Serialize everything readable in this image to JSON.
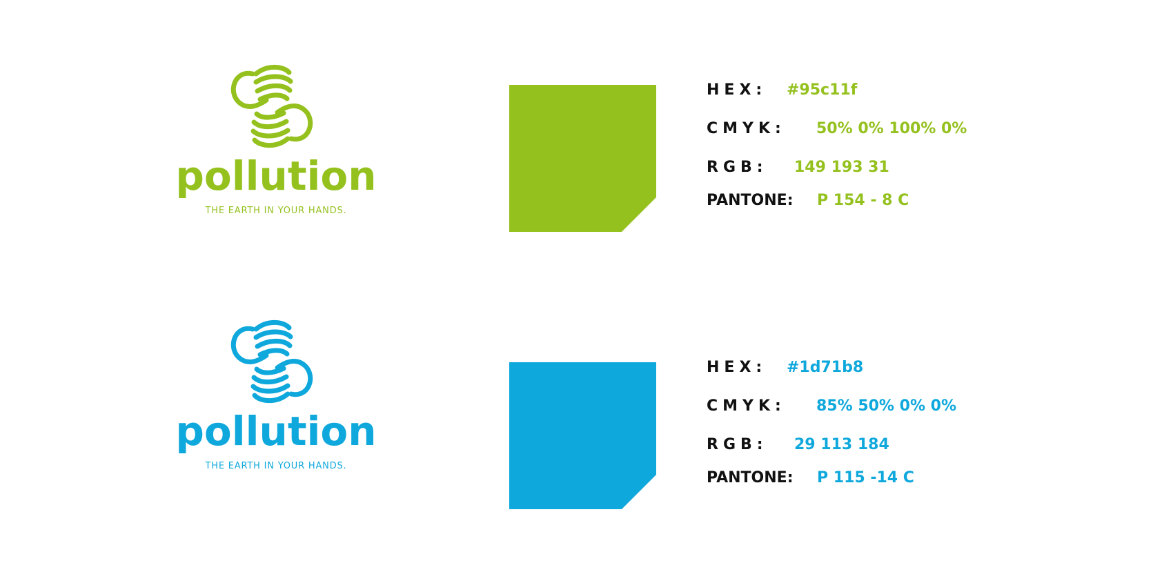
{
  "palettes": [
    {
      "color": "#95c11f",
      "logo": {
        "wordmark": "pollution",
        "tagline": "THE EARTH IN YOUR HANDS."
      },
      "specs": {
        "hex_label": "HEX:",
        "hex_value": "#95c11f",
        "cmyk_label": "CMYK:",
        "cmyk_value": "50% 0% 100% 0%",
        "rgb_label": "RGB:",
        "rgb_value": "149 193 31",
        "pantone_label": "PANTONE:",
        "pantone_value": "P 154 - 8 C"
      }
    },
    {
      "color": "#1d71b8",
      "logo": {
        "wordmark": "pollution",
        "tagline": "THE EARTH IN YOUR HANDS."
      },
      "specs": {
        "hex_label": "HEX:",
        "hex_value": "#1d71b8",
        "cmyk_label": "CMYK:",
        "cmyk_value": "85% 50% 0% 0%",
        "rgb_label": "RGB:",
        "rgb_value": "29 113 184",
        "pantone_label": "PANTONE:",
        "pantone_value": "P 115 -14 C"
      }
    }
  ],
  "display_colors": {
    "green": "#95c11f",
    "blue": "#0fa8dc",
    "text_dark": "#111111"
  }
}
